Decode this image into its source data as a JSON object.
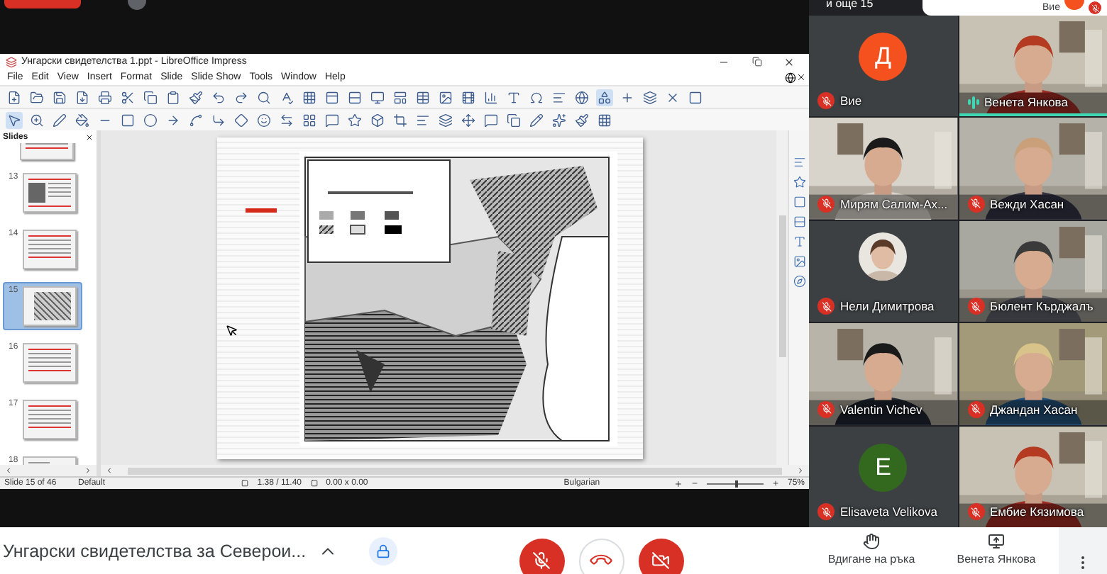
{
  "presenter_bar": {
    "others": "и още 15",
    "self_label": "Вие",
    "self_muted": true
  },
  "impress": {
    "title": "Унгарски свидетелства 1.ppt - LibreOffice Impress",
    "menu": [
      "File",
      "Edit",
      "View",
      "Insert",
      "Format",
      "Slide",
      "Slide Show",
      "Tools",
      "Window",
      "Help"
    ],
    "slides_panel": {
      "title": "Slides",
      "thumbnails": [
        {
          "number": "13",
          "kind": "portrait",
          "selected": false
        },
        {
          "number": "14",
          "kind": "text",
          "selected": false
        },
        {
          "number": "15",
          "kind": "map",
          "selected": true
        },
        {
          "number": "16",
          "kind": "text",
          "selected": false
        },
        {
          "number": "17",
          "kind": "text",
          "selected": false
        },
        {
          "number": "18",
          "kind": "document",
          "selected": false
        }
      ]
    },
    "status_bar": {
      "slide": "Slide 15 of 46",
      "layout": "Default",
      "position": "1.38 / 11.40",
      "size": "0.00 x 0.00",
      "language": "Bulgarian",
      "zoom": "75%",
      "zoom_slider": {
        "level": 0.5
      }
    }
  },
  "meeting_title": "Унгарски свидетелства за Северои...",
  "call_controls": [
    {
      "kind": "mic",
      "on": false
    },
    {
      "kind": "hangup"
    },
    {
      "kind": "camera",
      "on": false
    }
  ],
  "participants": [
    {
      "name": "Вие",
      "kind": "avatar",
      "initial": "Д",
      "color": "#f4511e",
      "muted": true,
      "speaking": false
    },
    {
      "name": "Венета Янкова",
      "kind": "video",
      "muted": false,
      "speaking": true
    },
    {
      "name": "Мирям Салим-Ах...",
      "kind": "video",
      "muted": true,
      "speaking": false
    },
    {
      "name": "Вежди Хасан",
      "kind": "video",
      "muted": true,
      "speaking": false
    },
    {
      "name": "Нели Димитрова",
      "muted": true,
      "speaking": false
    },
    {
      "name": "Бюлент Кърджалъ",
      "kind": "video",
      "muted": true,
      "speaking": false
    },
    {
      "name": "Valentin Vichev",
      "kind": "video",
      "muted": true,
      "speaking": false
    },
    {
      "name": "Джандан Хасан",
      "kind": "video",
      "muted": true,
      "speaking": false
    },
    {
      "name": "Elisaveta Velikova",
      "kind": "avatar",
      "initial": "E",
      "color": "#33691e",
      "muted": true,
      "speaking": false
    },
    {
      "name": "Ембие Кязимова",
      "kind": "video",
      "muted": true,
      "speaking": false
    }
  ],
  "bottom_actions": [
    {
      "kind": "raise-hand",
      "label": "Вдигане на ръка"
    },
    {
      "kind": "presenting",
      "label": "Венета Янкова"
    }
  ]
}
